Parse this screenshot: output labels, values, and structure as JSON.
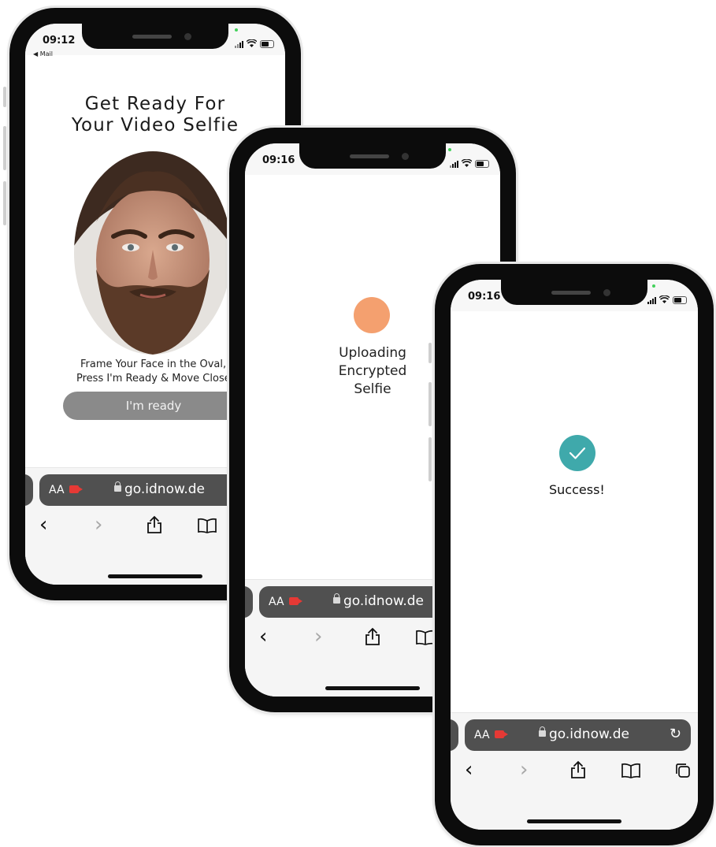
{
  "phone1": {
    "time": "09:12",
    "back_label": "◀ Mail",
    "title_line1": "Get Ready For",
    "title_line2": "Your Video Selfie",
    "instruction_line1": "Frame Your Face in the Oval,",
    "instruction_line2": "Press I'm Ready & Move Close",
    "ready_button": "I'm ready",
    "url_aa": "AA",
    "url": "go.idnow.de"
  },
  "phone2": {
    "time": "09:16",
    "status_line1": "Uploading",
    "status_line2": "Encrypted",
    "status_line3": "Selfie",
    "url_aa": "AA",
    "url": "go.idnow.de"
  },
  "phone3": {
    "time": "09:16",
    "success_text": "Success!",
    "url_aa": "AA",
    "url": "go.idnow.de"
  },
  "colors": {
    "upload_indicator": "#f4a06f",
    "success_check": "#3fa9ab",
    "record_icon": "#e53935",
    "ready_button": "#8a8a8a",
    "url_bar": "#505050"
  },
  "icons": [
    "back-chevron-icon",
    "forward-chevron-icon",
    "share-icon",
    "bookmarks-icon",
    "tabs-icon",
    "reload-icon",
    "lock-icon",
    "camera-record-icon",
    "wifi-icon",
    "battery-icon",
    "signal-icon",
    "checkmark-icon"
  ]
}
